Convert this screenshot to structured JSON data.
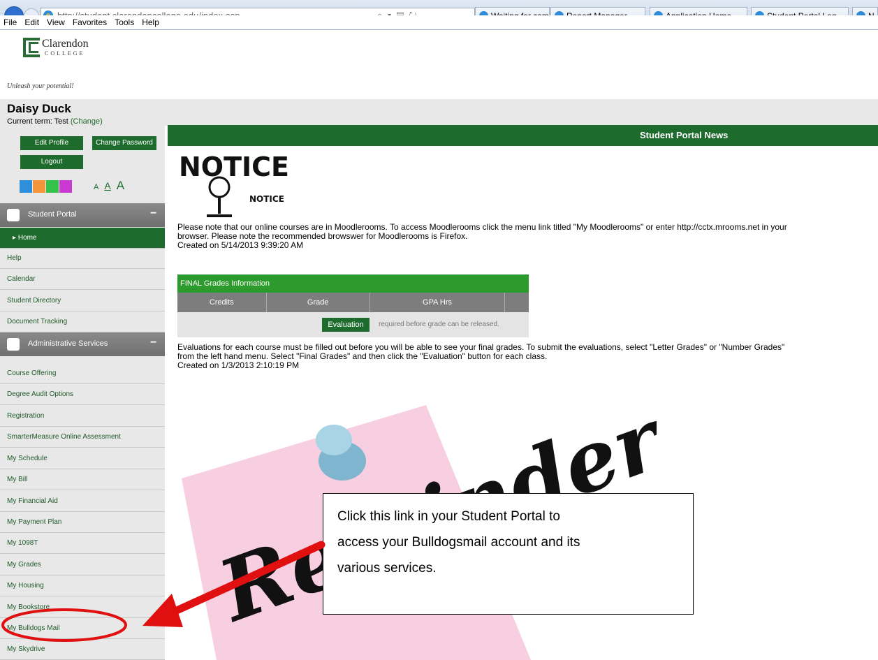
{
  "browser": {
    "url": "http://student.clarendoncollege.edu/index.asp",
    "tabs": [
      "Waiting for cams.cl...",
      "Report Manager",
      "Application Home...",
      "Student Portal Log...",
      "N"
    ],
    "menu": [
      "File",
      "Edit",
      "View",
      "Favorites",
      "Tools",
      "Help"
    ]
  },
  "header": {
    "logo_name": "Clarendon",
    "logo_sub": "COLLEGE",
    "tagline": "Unleash your potential!"
  },
  "user": {
    "name": "Daisy Duck",
    "term_label": "Current term: Test",
    "change_link": "(Change)",
    "edit_profile": "Edit Profile",
    "change_password": "Change Password",
    "logout": "Logout",
    "font_small": "A",
    "font_medium": "A",
    "font_large": "A"
  },
  "sidebar": {
    "section1": "Student Portal",
    "section1_items": [
      "Home",
      "Help",
      "Calendar",
      "Student Directory",
      "Document Tracking"
    ],
    "section2": "Administrative Services",
    "section2_items": [
      "Course Offering",
      "Degree Audit Options",
      "Registration",
      "SmarterMeasure Online Assessment",
      "My Schedule",
      "My Bill",
      "My Financial Aid",
      "My Payment Plan",
      "My 1098T",
      "My Grades",
      "My Housing",
      "My Bookstore",
      "My Bulldogs Mail",
      "My Skydrive"
    ],
    "section_toggle": "−"
  },
  "main": {
    "news_title": "Student Portal News",
    "notice_big": "NOTICE",
    "notice_small": "NOTICE",
    "news1_line1": "Please note that our online courses are in Moodlerooms. To access Moodlerooms click the menu link titled \"My Moodlerooms\" or enter http://cctx.mrooms.net in your",
    "news1_line2": "browser. Please note the recommended browswer for Moodlerooms is Firefox.",
    "news1_date": "Created on 5/14/2013 9:39:20 AM",
    "grades_title": "FINAL Grades Information",
    "grades_cols": [
      "Credits",
      "Grade",
      "GPA Hrs"
    ],
    "evaluation_btn": "Evaluation",
    "evaluation_note": "required before grade can be released.",
    "news2_line1": "Evaluations for each course must be filled out before you will be able to see your final grades. To submit the evaluations, select \"Letter Grades\" or \"Number Grades\"",
    "news2_line2": "from the left hand menu. Select \"Final Grades\" and then click the \"Evaluation\" button for each class.",
    "news2_date": "Created on 1/3/2013 2:10:19 PM",
    "reminder_text": "Reminder!"
  },
  "callout": {
    "line1": "Click this link in your Student Portal to",
    "line2": "access your Bulldogsmail account and its",
    "line3": "various services."
  },
  "colors": {
    "portal_green": "#1e6b2e",
    "table_green": "#2d9a2d",
    "annotation_red": "#e01010",
    "sticky_pink": "#f7cfe0"
  }
}
